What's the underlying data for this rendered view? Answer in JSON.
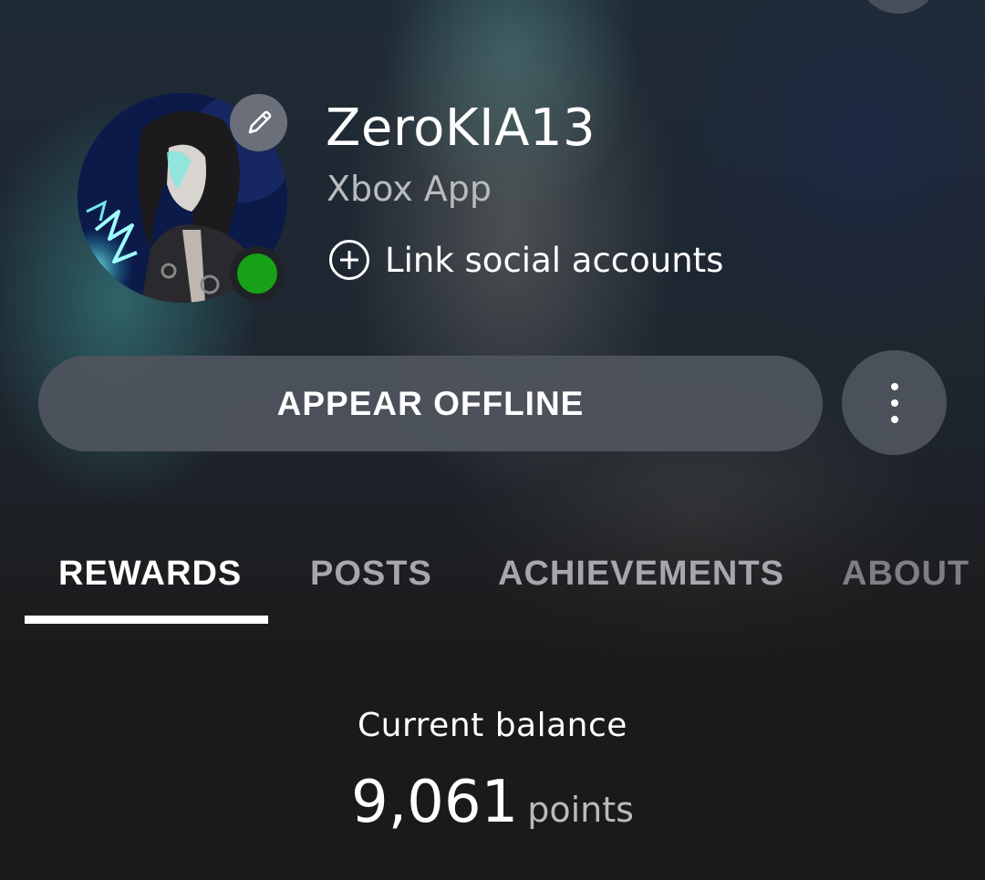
{
  "profile": {
    "gamertag": "ZeroKIA13",
    "app_name": "Xbox App",
    "link_social_label": "Link social accounts",
    "status": "online",
    "status_color": "#16a116"
  },
  "actions": {
    "appear_offline_label": "APPEAR OFFLINE",
    "more_icon": "more-vertical-icon",
    "edit_icon": "pencil-icon"
  },
  "tabs": [
    {
      "label": "REWARDS",
      "active": true
    },
    {
      "label": "POSTS",
      "active": false
    },
    {
      "label": "ACHIEVEMENTS",
      "active": false
    },
    {
      "label": "ABOUT",
      "active": false
    }
  ],
  "rewards": {
    "balance_label": "Current balance",
    "balance_value": "9,061",
    "balance_unit": "points"
  }
}
